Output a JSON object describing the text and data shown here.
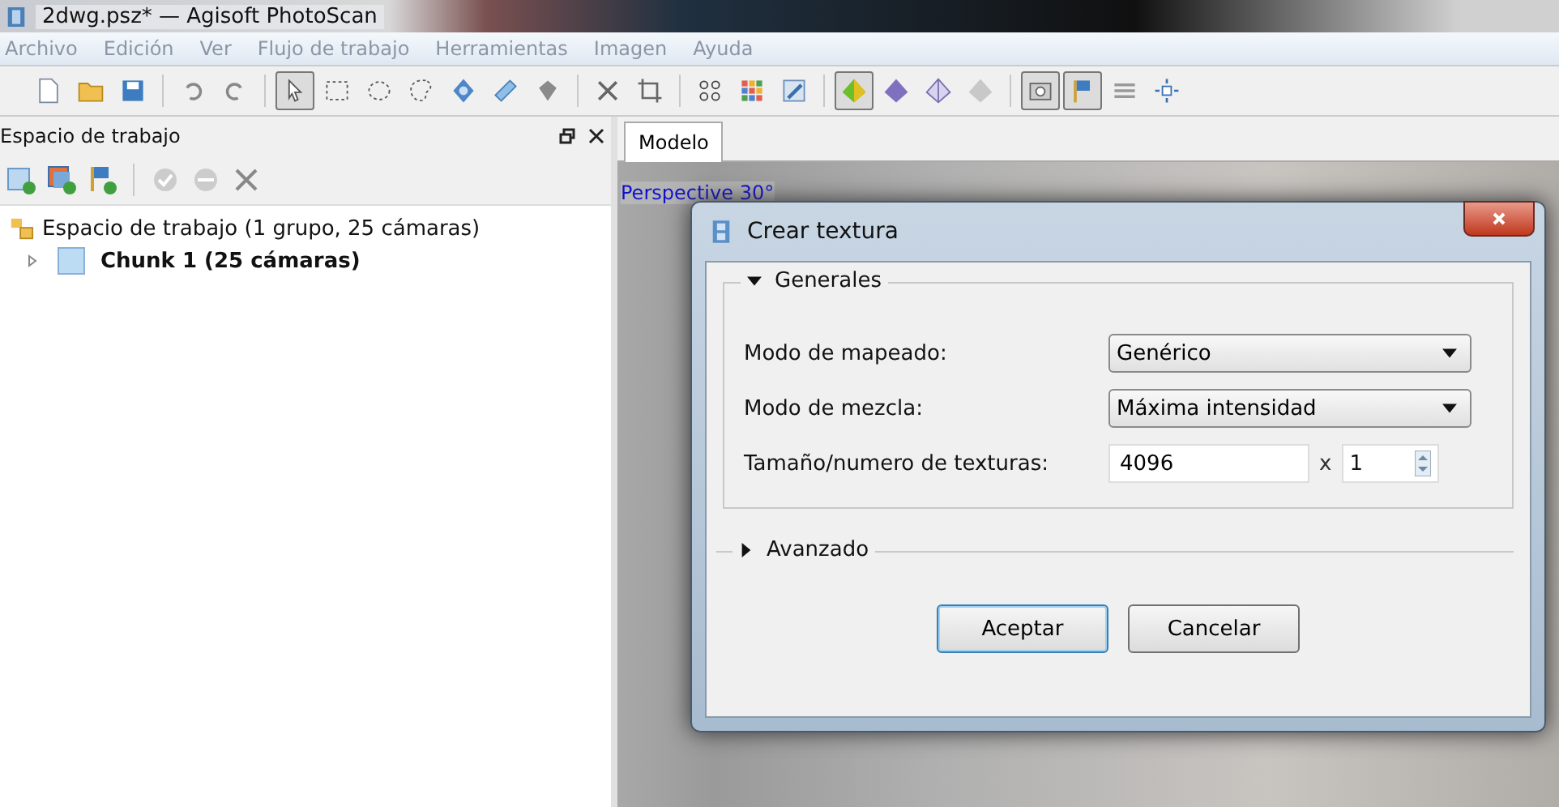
{
  "window": {
    "title": "2dwg.psz* — Agisoft PhotoScan"
  },
  "menu": [
    "Archivo",
    "Edición",
    "Ver",
    "Flujo de trabajo",
    "Herramientas",
    "Imagen",
    "Ayuda"
  ],
  "toolbar": [
    {
      "selected": false
    },
    {
      "selected": false
    },
    {
      "selected": false
    },
    {
      "selected": false
    },
    {
      "selected": false
    },
    {
      "selected": true
    },
    {
      "selected": false
    },
    {
      "selected": false
    },
    {
      "selected": false
    },
    {
      "selected": false
    },
    {
      "selected": false
    },
    {
      "selected": false
    },
    {
      "selected": false
    },
    {
      "selected": false
    },
    {
      "selected": false
    },
    {
      "selected": false
    },
    {
      "selected": false
    },
    {
      "selected": true
    },
    {
      "selected": false
    },
    {
      "selected": false
    },
    {
      "selected": false
    },
    {
      "selected": true
    },
    {
      "selected": true
    },
    {
      "selected": false
    },
    {
      "selected": false
    }
  ],
  "workspace": {
    "title": "Espacio de trabajo",
    "tree": {
      "label": "Espacio de trabajo (1 grupo, 25 cámaras)",
      "children": [
        {
          "label": "Chunk 1 (25 cámaras)",
          "expanded": false
        }
      ]
    }
  },
  "tabs": [
    {
      "label": "Modelo",
      "selected": true
    }
  ],
  "viewport": {
    "projection": "Perspective 30°"
  },
  "dialog": {
    "title": "Crear textura",
    "groups": [
      {
        "label": "Generales",
        "expanded": true,
        "rows": [
          {
            "kind": "combo",
            "label": "Modo de mapeado:",
            "value": "Genérico"
          },
          {
            "kind": "combo",
            "label": "Modo de mezcla:",
            "value": "Máxima intensidad"
          },
          {
            "kind": "size",
            "label": "Tamaño/numero de texturas:",
            "value": "4096",
            "times": "x",
            "count": "1"
          }
        ]
      },
      {
        "label": "Avanzado",
        "expanded": false
      }
    ],
    "buttons": [
      {
        "label": "Aceptar",
        "default": true
      },
      {
        "label": "Cancelar",
        "default": false
      }
    ]
  }
}
